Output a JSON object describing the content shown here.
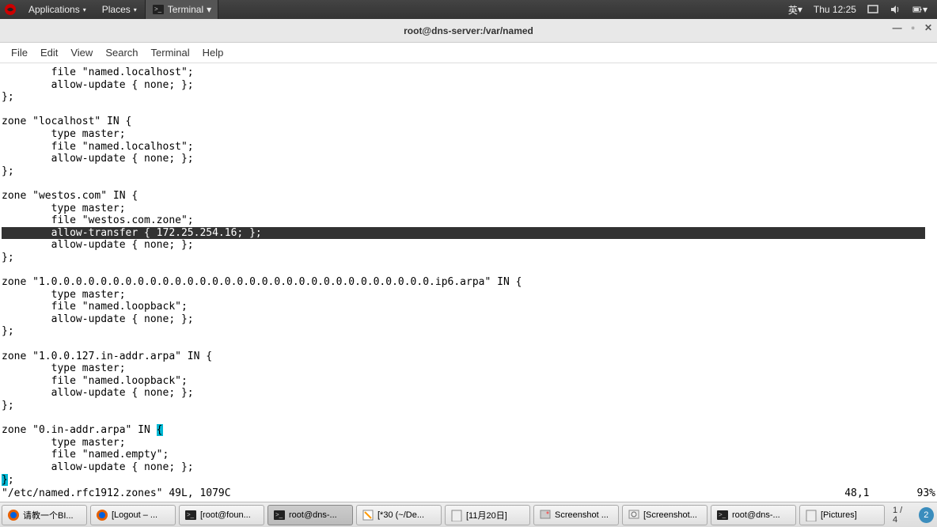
{
  "top_panel": {
    "applications": "Applications",
    "places": "Places",
    "terminal": "Terminal",
    "ime": "英",
    "clock": "Thu 12:25"
  },
  "window": {
    "title": "root@dns-server:/var/named",
    "menu": {
      "file": "File",
      "edit": "Edit",
      "view": "View",
      "search": "Search",
      "terminal": "Terminal",
      "help": "Help"
    }
  },
  "editor": {
    "lines_before": "        file \"named.localhost\";\n        allow-update { none; };\n};\n\nzone \"localhost\" IN {\n        type master;\n        file \"named.localhost\";\n        allow-update { none; };\n};\n\nzone \"westos.com\" IN {\n        type master;\n        file \"westos.com.zone\";\n",
    "hl_line": "        allow-transfer { 172.25.254.16; };",
    "lines_after_1": "        allow-update { none; };\n};\n\nzone \"1.0.0.0.0.0.0.0.0.0.0.0.0.0.0.0.0.0.0.0.0.0.0.0.0.0.0.0.0.0.0.0.ip6.arpa\" IN {\n        type master;\n        file \"named.loopback\";\n        allow-update { none; };\n};\n\nzone \"1.0.0.127.in-addr.arpa\" IN {\n        type master;\n        file \"named.loopback\";\n        allow-update { none; };\n};\n\nzone \"0.in-addr.arpa\" IN ",
    "cursor_char": "{",
    "lines_after_2": "\n        type master;\n        file \"named.empty\";\n        allow-update { none; };\n",
    "bracket_match": "}",
    "lines_after_3": ";",
    "status_text": "\"/etc/named.rfc1912.zones\" 49L, 1079C",
    "pos": "48,1",
    "pct": "93%"
  },
  "taskbar": {
    "items": [
      "请教一个BI...",
      "[Logout – ...",
      "[root@foun...",
      "root@dns-...",
      "[*30 (~/De...",
      "[11月20日]",
      "Screenshot ...",
      "[Screenshot...",
      "root@dns-...",
      "[Pictures]"
    ],
    "active_index": 3,
    "workspace": "1 / 4",
    "tray_num": "2"
  }
}
